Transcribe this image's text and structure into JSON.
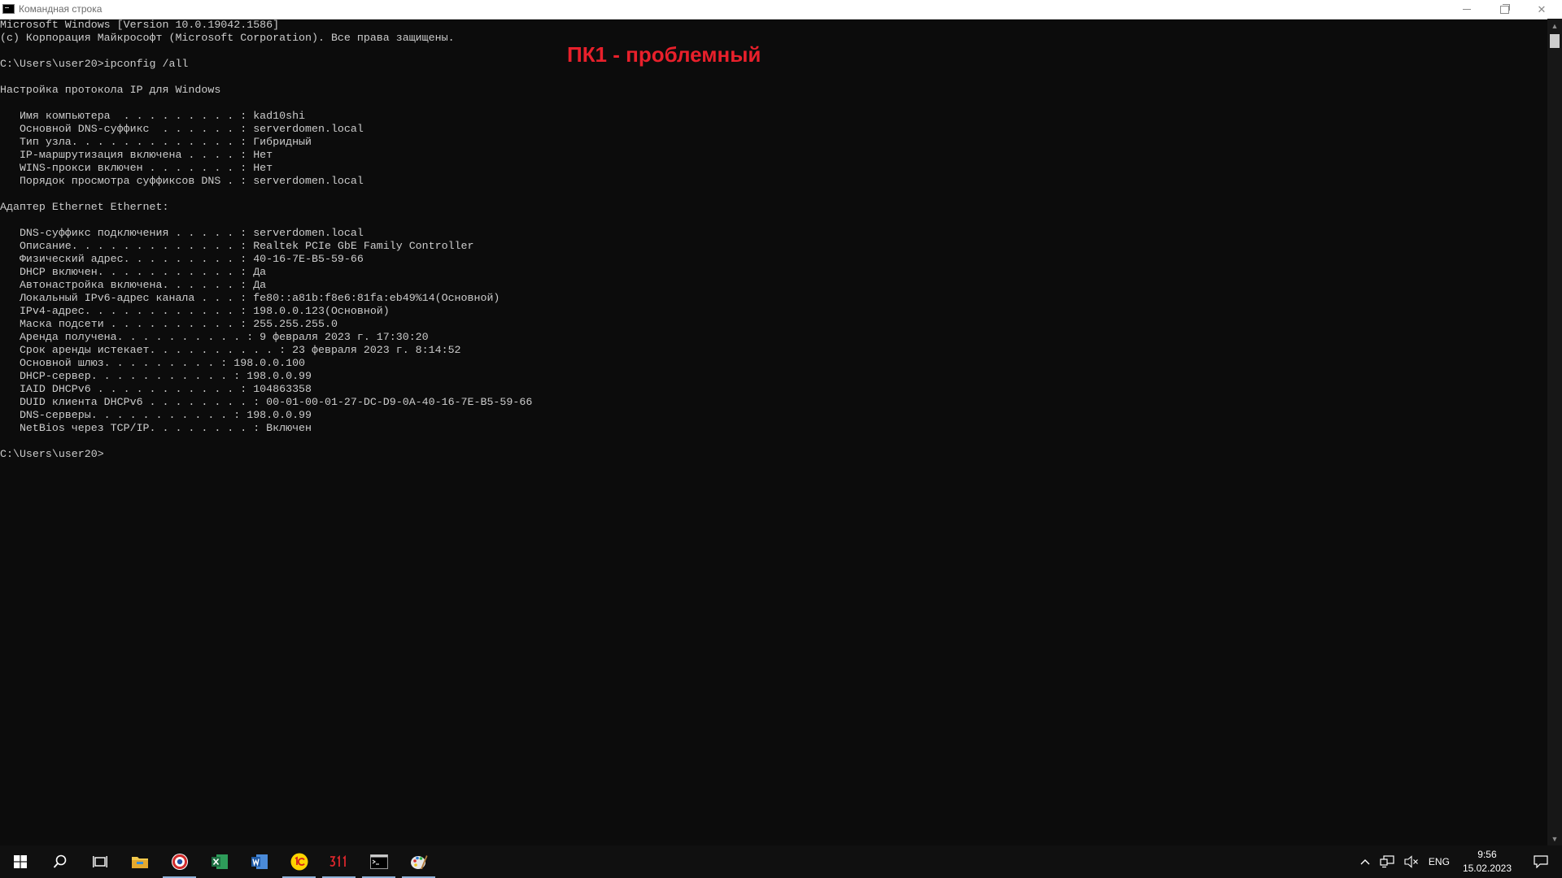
{
  "window": {
    "title": "Командная строка"
  },
  "console": {
    "lines": [
      "Microsoft Windows [Version 10.0.19042.1586]",
      "(c) Корпорация Майкрософт (Microsoft Corporation). Все права защищены.",
      "",
      "C:\\Users\\user20>ipconfig /all",
      "",
      "Настройка протокола IP для Windows",
      "",
      "   Имя компьютера  . . . . . . . . . : kad10shi",
      "   Основной DNS-суффикс  . . . . . . : serverdomen.local",
      "   Тип узла. . . . . . . . . . . . . : Гибридный",
      "   IP-маршрутизация включена . . . . : Нет",
      "   WINS-прокси включен . . . . . . . : Нет",
      "   Порядок просмотра суффиксов DNS . : serverdomen.local",
      "",
      "Адаптер Ethernet Ethernet:",
      "",
      "   DNS-суффикс подключения . . . . . : serverdomen.local",
      "   Описание. . . . . . . . . . . . . : Realtek PCIe GbE Family Controller",
      "   Физический адрес. . . . . . . . . : 40-16-7E-B5-59-66",
      "   DHCP включен. . . . . . . . . . . : Да",
      "   Автонастройка включена. . . . . . : Да",
      "   Локальный IPv6-адрес канала . . . : fe80::a81b:f8e6:81fa:eb49%14(Основной)",
      "   IPv4-адрес. . . . . . . . . . . . : 198.0.0.123(Основной)",
      "   Маска подсети . . . . . . . . . . : 255.255.255.0",
      "   Аренда получена. . . . . . . . . . : 9 февраля 2023 г. 17:30:20",
      "   Срок аренды истекает. . . . . . . . . . : 23 февраля 2023 г. 8:14:52",
      "   Основной шлюз. . . . . . . . . : 198.0.0.100",
      "   DHCP-сервер. . . . . . . . . . . : 198.0.0.99",
      "   IAID DHCPv6 . . . . . . . . . . . : 104863358",
      "   DUID клиента DHCPv6 . . . . . . . . : 00-01-00-01-27-DC-D9-0A-40-16-7E-B5-59-66",
      "   DNS-серверы. . . . . . . . . . . : 198.0.0.99",
      "   NetBios через TCP/IP. . . . . . . . : Включен",
      "",
      "C:\\Users\\user20>"
    ]
  },
  "annotation": {
    "text": "ПК1 - проблемный",
    "color": "#e8202b"
  },
  "taskbar": {
    "apps": [
      {
        "name": "start-icon",
        "active": false
      },
      {
        "name": "search-icon",
        "active": false
      },
      {
        "name": "task-view-icon",
        "active": false
      },
      {
        "name": "file-explorer-icon",
        "active": false
      },
      {
        "name": "browser-icon",
        "active": true
      },
      {
        "name": "excel-icon",
        "active": false
      },
      {
        "name": "word-icon",
        "active": false
      },
      {
        "name": "1c-icon",
        "active": true
      },
      {
        "name": "311-app-icon",
        "active": true
      },
      {
        "name": "command-prompt-icon",
        "active": true
      },
      {
        "name": "paint-icon",
        "active": true
      }
    ],
    "tray": {
      "language": "ENG",
      "time": "9:56",
      "date": "15.02.2023"
    }
  }
}
